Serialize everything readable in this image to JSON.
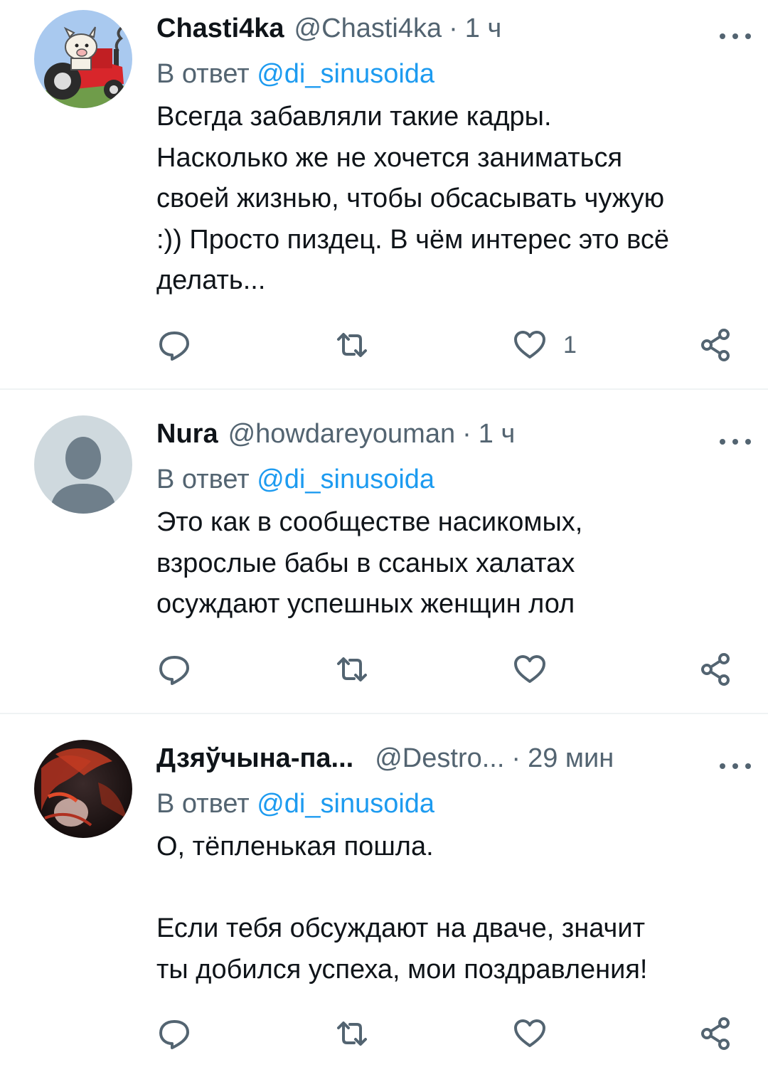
{
  "tweets": [
    {
      "name": "Chasti4ka",
      "handle": "@Chasti4ka",
      "separator": "·",
      "time": "1 ч",
      "reply_prefix": "В ответ",
      "reply_mention": "@di_sinusoida",
      "text": "Всегда забавляли такие кадры.\nНасколько же не хочется заниматься\nсвоей жизнью, чтобы обсасывать чужую\n:)) Просто пиздец. В чём интерес это всё\nделать...",
      "like_count": "1",
      "avatar_icon": "tractor-pig-avatar"
    },
    {
      "name": "Nura",
      "handle": "@howdareyouman",
      "separator": "·",
      "time": "1 ч",
      "reply_prefix": "В ответ",
      "reply_mention": "@di_sinusoida",
      "text": "Это как в сообществе насикомых,\nвзрослые бабы в ссаных халатах\nосуждают успешных женщин лол",
      "like_count": "",
      "avatar_icon": "default-user-avatar"
    },
    {
      "name": "Дзяўчына-па...",
      "handle": "@Destro...",
      "separator": "·",
      "time": "29 мин",
      "reply_prefix": "В ответ",
      "reply_mention": "@di_sinusoida",
      "text": "О, тёпленькая пошла.\n\nЕсли тебя обсуждают на дваче, значит\nты добился успеха, мои поздравления!",
      "like_count": "",
      "avatar_icon": "red-hair-portrait-avatar"
    }
  ],
  "colors": {
    "text": "#0f1419",
    "secondary": "#536471",
    "link": "#1d9bf0",
    "divider": "#eff3f4"
  }
}
